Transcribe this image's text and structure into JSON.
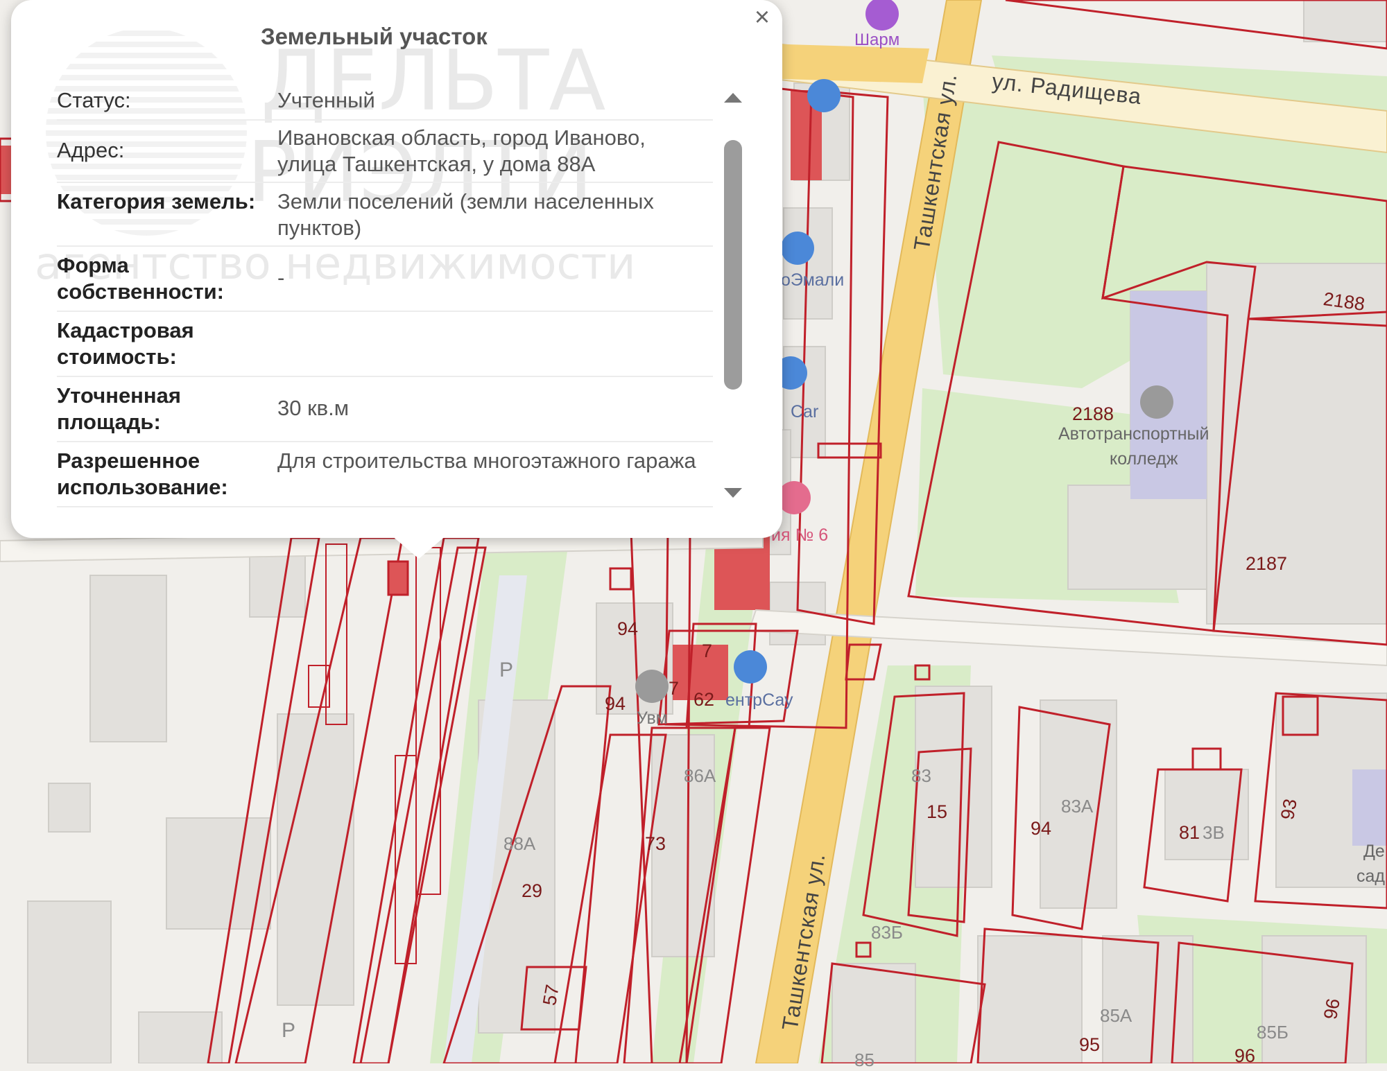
{
  "popup": {
    "title": "Земельный участок",
    "close_label": "×",
    "rows": [
      {
        "key": "Статус:",
        "value": "Учтенный"
      },
      {
        "key": "Адрес:",
        "value": "Ивановская область, город Иваново, улица Ташкентская, у дома 88А"
      },
      {
        "key": "Категория земель:",
        "value": "Земли поселений (земли населенных пунктов)"
      },
      {
        "key": "Форма собственности:",
        "value": "-"
      },
      {
        "key": "Кадастровая стоимость:",
        "value": ""
      },
      {
        "key": "Уточненная площадь:",
        "value": "30 кв.м"
      },
      {
        "key": "Разрешенное использование:",
        "value": "Для строительства многоэтажного гаража"
      }
    ],
    "watermark_line1": "ДЕЛЬТА",
    "watermark_line2": "РИЭЛТИ",
    "watermark_line3": "агентство недвижимости"
  },
  "map": {
    "streets": {
      "radishcheva": "ул. Радищева",
      "tashkentskaya_top": "Ташкентская ул.",
      "tashkentskaya_bottom": "Ташкентская ул."
    },
    "pois": {
      "sharm": "Шарм",
      "emali": "оЭмали",
      "car": "Car",
      "school6": "ия № 6",
      "college_line1": "Автотранспортный",
      "college_line2": "колледж",
      "uvm": "Увм",
      "centr": "ентрСау",
      "det_line1": "Де",
      "det_line2": "сад"
    },
    "plot_numbers": {
      "p2188a": "2188",
      "p2188b": "2188",
      "p2187": "2187",
      "p94a": "94",
      "p94b": "94",
      "p94c": "94",
      "p7a": "7",
      "p7b": "7",
      "p62": "62",
      "p73": "73",
      "p29": "29",
      "p57": "57",
      "p15": "15",
      "p81": "81",
      "p93": "93",
      "p95": "95",
      "p96a": "96",
      "p96b": "96"
    },
    "house_numbers": {
      "h86a": "86А",
      "h88a": "88А",
      "h83": "83",
      "h83a": "83А",
      "h83b": "83Б",
      "h3v": "3В",
      "h85a": "85А",
      "h85b": "85Б",
      "h85": "85"
    },
    "parking_a": "P",
    "parking_b": "P"
  },
  "colors": {
    "plot_border": "#c0202a",
    "road_yellow": "#f5d27a",
    "green": "#d9ecc8",
    "building": "#e2e0dc",
    "popup_bg": "#ffffff"
  }
}
